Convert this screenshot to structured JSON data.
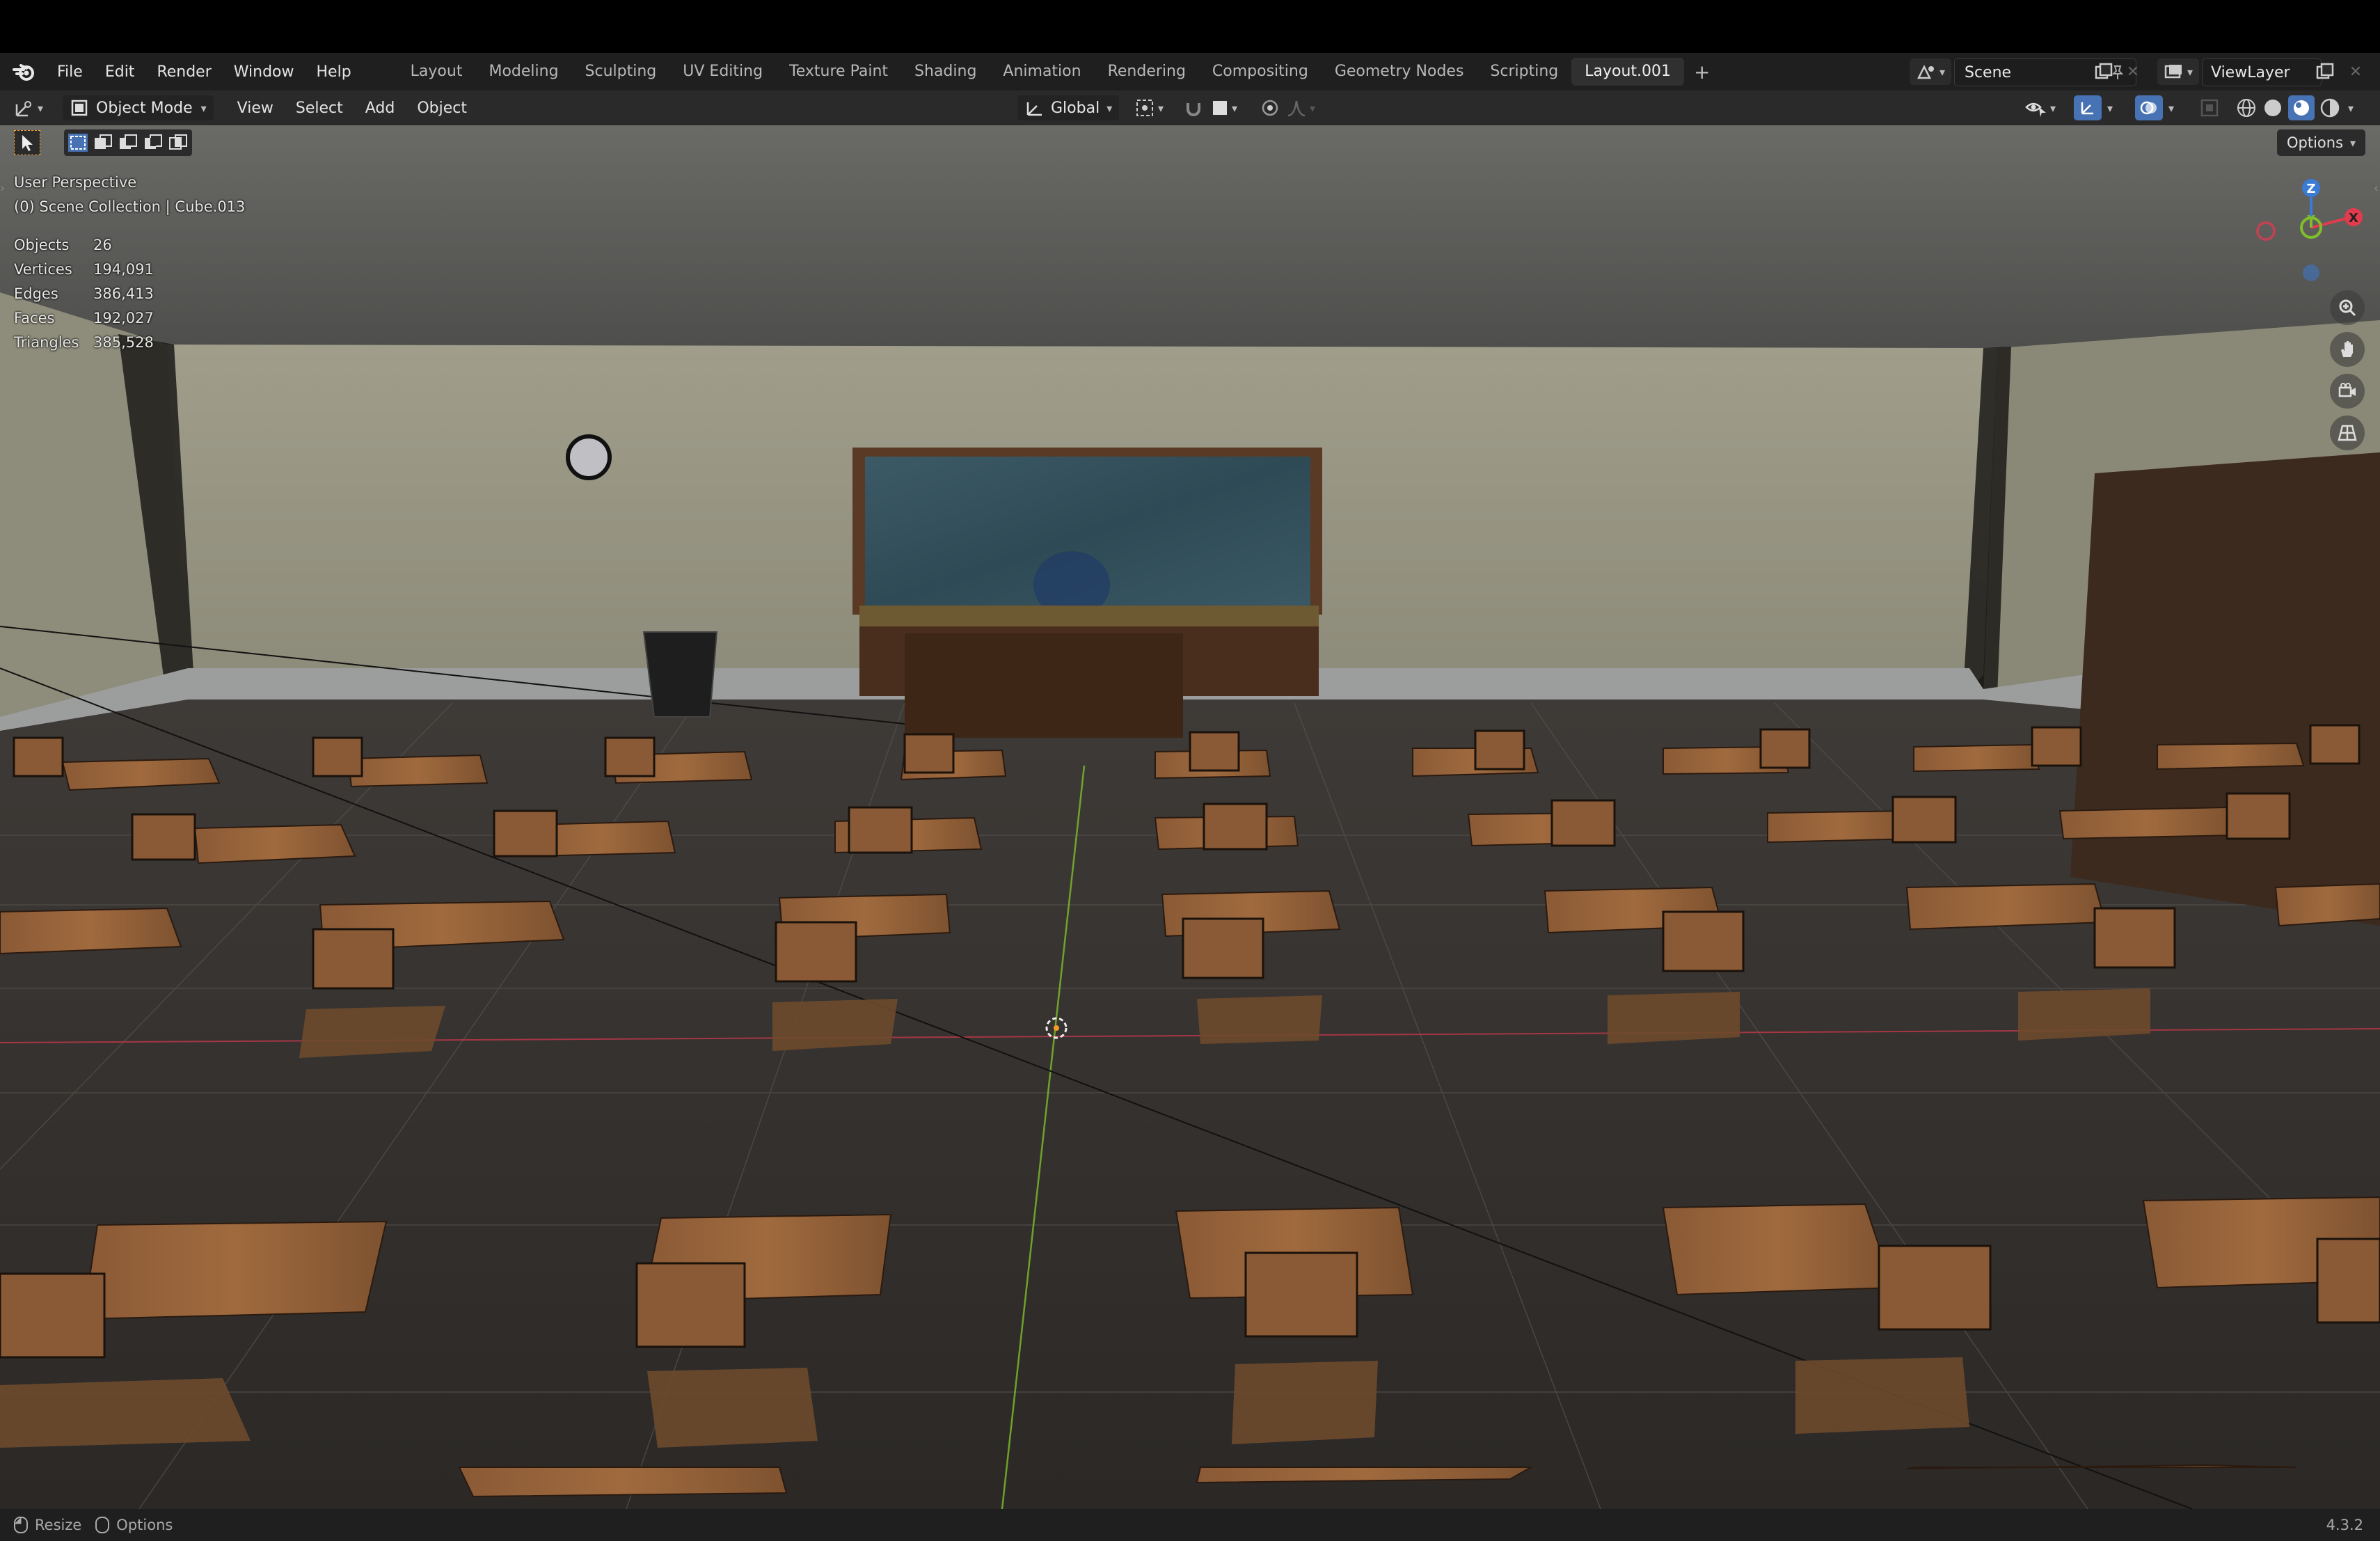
{
  "menubar": {
    "items": [
      "File",
      "Edit",
      "Render",
      "Window",
      "Help"
    ],
    "workspaces": [
      "Layout",
      "Modeling",
      "Sculpting",
      "UV Editing",
      "Texture Paint",
      "Shading",
      "Animation",
      "Rendering",
      "Compositing",
      "Geometry Nodes",
      "Scripting",
      "Layout.001"
    ],
    "active_workspace": "Layout.001",
    "scene": "Scene",
    "view_layer": "ViewLayer"
  },
  "viewport_header": {
    "mode": "Object Mode",
    "menus": [
      "View",
      "Select",
      "Add",
      "Object"
    ],
    "transform_orientation": "Global",
    "options": "Options"
  },
  "overlay": {
    "perspective": "User Perspective",
    "collection": "(0) Scene Collection | Cube.013",
    "stats": [
      {
        "label": "Objects",
        "value": "26"
      },
      {
        "label": "Vertices",
        "value": "194,091"
      },
      {
        "label": "Edges",
        "value": "386,413"
      },
      {
        "label": "Faces",
        "value": "192,027"
      },
      {
        "label": "Triangles",
        "value": "385,528"
      }
    ]
  },
  "gizmo": {
    "z": "Z",
    "y": "Y",
    "x": "X"
  },
  "statusbar": {
    "resize": "Resize",
    "options": "Options",
    "version": "4.3.2"
  },
  "colors": {
    "accent": "#4772b3",
    "x_axis": "#e23b4e",
    "y_axis": "#7fbf2a",
    "z_axis": "#3a7bd5"
  }
}
